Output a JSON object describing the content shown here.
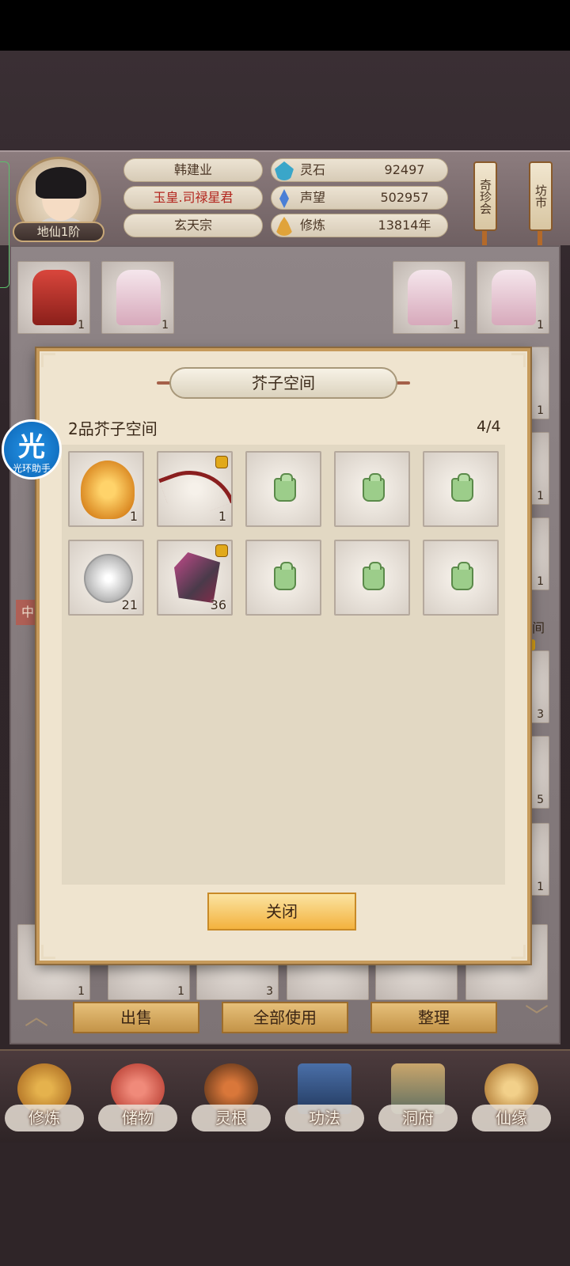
{
  "player": {
    "name": "韩建业",
    "title": "玉皇.司禄星君",
    "sect": "玄天宗",
    "rank": "地仙1阶"
  },
  "stats": [
    {
      "label": "灵石",
      "value": "92497",
      "icon": "spirit-stone-icon",
      "color": "#3aa6c9"
    },
    {
      "label": "声望",
      "value": "502957",
      "icon": "reputation-icon",
      "color": "#4a7fd6"
    },
    {
      "label": "修炼",
      "value": "13814年",
      "icon": "meditation-icon",
      "color": "#e0a33a"
    }
  ],
  "side_signs": {
    "treasure_fair": "奇珍会",
    "market": "坊市"
  },
  "inventory": {
    "top_counts": [
      "1",
      "1",
      "1",
      "1"
    ],
    "right_counts": [
      "1",
      "1",
      "1",
      "3",
      "5",
      "1"
    ],
    "bottom_counts": [
      "1",
      "1",
      "3"
    ],
    "side_tag": "中",
    "space_label": "空间"
  },
  "actions": {
    "sell": "出售",
    "use_all": "全部使用",
    "sort": "整理"
  },
  "nav": [
    {
      "label": "修炼",
      "icon": "cultivation-icon"
    },
    {
      "label": "储物",
      "icon": "storage-bag-icon"
    },
    {
      "label": "灵根",
      "icon": "spirit-root-icon"
    },
    {
      "label": "功法",
      "icon": "technique-book-icon"
    },
    {
      "label": "洞府",
      "icon": "cave-dwelling-icon"
    },
    {
      "label": "仙缘",
      "icon": "immortal-fate-icon"
    }
  ],
  "modal": {
    "title": "芥子空间",
    "subtitle": "2品芥子空间",
    "capacity": "4/4",
    "close_label": "关闭",
    "slots": [
      {
        "item": "golden-buddha-icon",
        "count": "1",
        "locked": false
      },
      {
        "item": "red-bow-icon",
        "count": "1",
        "locked": true
      },
      {
        "item": "empty-bag-icon",
        "count": "",
        "locked": false
      },
      {
        "item": "empty-bag-icon",
        "count": "",
        "locked": false
      },
      {
        "item": "empty-bag-icon",
        "count": "",
        "locked": false
      },
      {
        "item": "spirit-orb-icon",
        "count": "21",
        "locked": false
      },
      {
        "item": "crystal-ore-icon",
        "count": "36",
        "locked": true
      },
      {
        "item": "empty-bag-icon",
        "count": "",
        "locked": false
      },
      {
        "item": "empty-bag-icon",
        "count": "",
        "locked": false
      },
      {
        "item": "empty-bag-icon",
        "count": "",
        "locked": false
      }
    ]
  },
  "assistant": {
    "glyph": "光",
    "label": "光环助手"
  }
}
